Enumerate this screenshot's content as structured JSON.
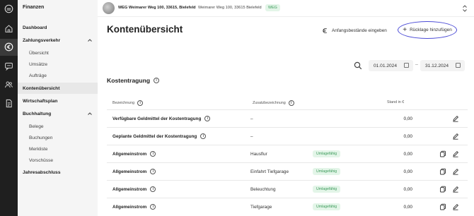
{
  "rail": {
    "icons": [
      "logo-icon",
      "home-icon",
      "euro-icon",
      "chat-icon",
      "users-icon",
      "document-icon"
    ]
  },
  "sidebar": {
    "title": "Finanzen",
    "items": [
      {
        "label": "Dashboard"
      },
      {
        "label": "Zahlungsverkehr"
      },
      {
        "label": "Übersicht"
      },
      {
        "label": "Umsätze"
      },
      {
        "label": "Aufträge"
      },
      {
        "label": "Kontenübersicht"
      },
      {
        "label": "Wirtschaftsplan"
      },
      {
        "label": "Buchhaltung"
      },
      {
        "label": "Belege"
      },
      {
        "label": "Buchungen"
      },
      {
        "label": "Merkliste"
      },
      {
        "label": "Vorschüsse"
      },
      {
        "label": "Jahresabschluss"
      }
    ]
  },
  "topbar": {
    "property_name": "WEG Weimarer Weg 100, 33615, Bielefeld",
    "property_address": "Weimarer Weg 100, 33615 Bielefeld",
    "badge": "WEG"
  },
  "main": {
    "title": "Kontenübersicht",
    "btn_anfang": "Anfangsbestände eingeben",
    "btn_ruecklage": "Rücklage hinzufügen",
    "date_from": "01.01.2024",
    "date_sep": "–",
    "date_to": "31.12.2024",
    "section_title": "Kostentragung",
    "columns": {
      "bezeichnung": "Bezeichnung",
      "zusatz": "Zusatzbezeichnung",
      "stand": "Stand in €"
    },
    "rows": [
      {
        "name": "Verfügbare Geldmittel der Kostentragung",
        "zusatz": "–",
        "tag": "",
        "amount": "0,00"
      },
      {
        "name": "Geplante Geldmittel der Kostentragung",
        "zusatz": "–",
        "tag": "",
        "amount": "0,00"
      },
      {
        "name": "Allgemeinstrom",
        "zusatz": "Hausflur",
        "tag": "Umlagefähig",
        "amount": "0,00"
      },
      {
        "name": "Allgemeinstrom",
        "zusatz": "Einfahrt Tiefgarage",
        "tag": "Umlagefähig",
        "amount": "0,00"
      },
      {
        "name": "Allgemeinstrom",
        "zusatz": "Beleuchtung",
        "tag": "Umlagefähig",
        "amount": "0,00"
      },
      {
        "name": "Allgemeinstrom",
        "zusatz": "Tiefgarage",
        "tag": "Umlagefähig",
        "amount": "0,00"
      }
    ]
  },
  "colors": {
    "rail_bg": "#1f1f1f",
    "sidebar_bg": "#f5f5f5",
    "badge_green": "#3c9a5a",
    "highlight": "#4b4bd6"
  }
}
